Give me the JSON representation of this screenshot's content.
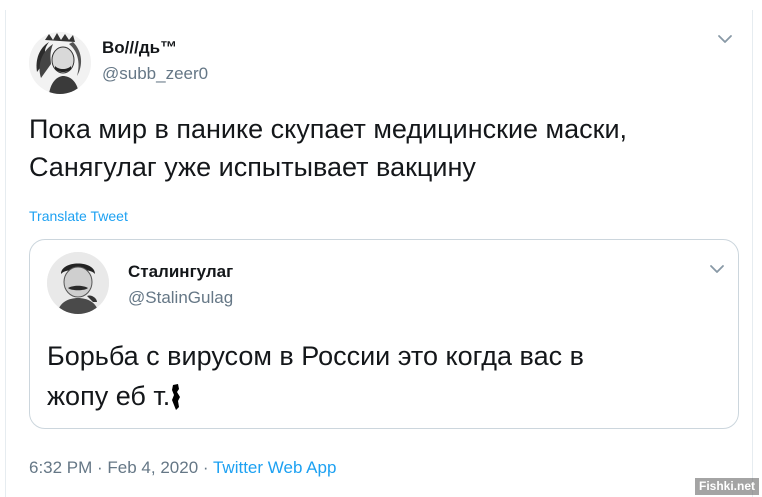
{
  "tweet": {
    "author": {
      "name": "Во///дь™",
      "handle": "@subb_zeer0"
    },
    "text_lines": [
      "Пока мир в панике скупает медицинские маски,",
      "Санягулаг уже испытывает вакцину"
    ],
    "translate_label": "Translate Tweet",
    "timestamp": "6:32 PM · Feb 4, 2020 · ",
    "source": "Twitter Web App"
  },
  "quoted_tweet": {
    "author": {
      "name": "Сталингулаг",
      "handle": "@StalinGulag"
    },
    "text_lines": [
      "Борьба с вирусом в России это когда вас в",
      "жопу еб  т."
    ]
  },
  "watermark": "Fishki.net",
  "colors": {
    "link": "#1da1f2",
    "secondary_text": "#657786",
    "primary_text": "#14171a",
    "border": "#ccd6dd"
  },
  "icons": {
    "tweet_menu": "chevron-down-icon",
    "quote_menu": "chevron-down-icon"
  }
}
